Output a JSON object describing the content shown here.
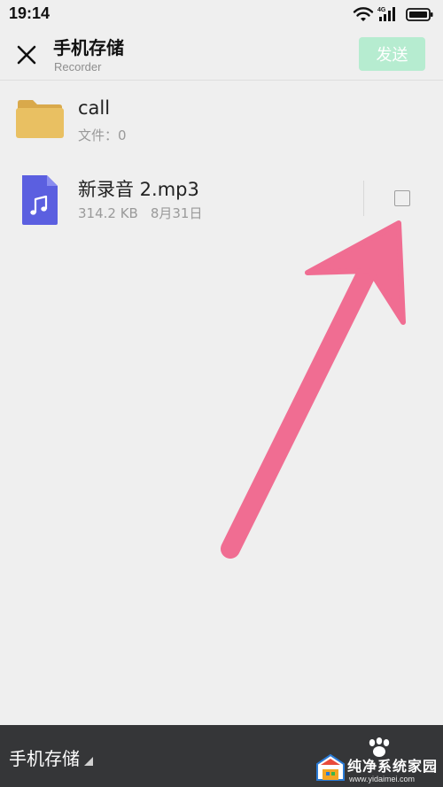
{
  "status_bar": {
    "time": "19:14",
    "network_label": "4G"
  },
  "header": {
    "close_icon": "close-icon",
    "title": "手机存储",
    "subtitle": "Recorder",
    "send_label": "发送"
  },
  "files": [
    {
      "icon": "folder-icon",
      "name": "call",
      "meta": [
        "文件：0"
      ]
    },
    {
      "icon": "music-file-icon",
      "name": "新录音 2.mp3",
      "meta": [
        "314.2 KB",
        "8月31日"
      ],
      "selected": false
    }
  ],
  "bottom_bar": {
    "storage_label": "手机存储",
    "paw_icon": "paw-icon"
  },
  "watermark": {
    "title": "纯净系统家园",
    "url": "www.yidaimei.com"
  },
  "colors": {
    "background": "#efefef",
    "send_disabled": "#b6ecd0",
    "folder": "#e9c062",
    "music_file": "#5b5fe0",
    "annotation_arrow": "#f06d92",
    "bottom_bar": "#353638"
  }
}
